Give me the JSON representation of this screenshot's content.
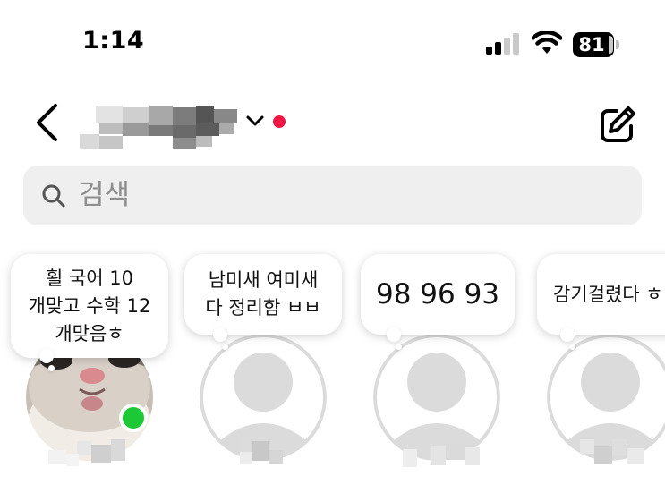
{
  "status_bar": {
    "time": "1:14",
    "battery": "81"
  },
  "header": {
    "back_icon": "chevron-left-icon",
    "username_display": "blurred",
    "dropdown_icon": "chevron-down-icon",
    "notification_dot_color": "#ef1744",
    "compose_icon": "compose-icon"
  },
  "search": {
    "placeholder": "검색",
    "icon": "search-icon"
  },
  "notes": [
    {
      "text": "횔 국어 10\n개맞고 수학 12\n개맞음ㅎ",
      "avatar": "cat-photo",
      "online": true,
      "online_color": "#1dc837"
    },
    {
      "text": "남미새 여미새\n다 정리함 ㅂㅂ",
      "avatar": "default-avatar",
      "online": false
    },
    {
      "text": "98 96 93",
      "avatar": "default-avatar",
      "online": false
    },
    {
      "text": "감기걸렸다 ㅎ",
      "avatar": "default-avatar",
      "online": false
    }
  ]
}
